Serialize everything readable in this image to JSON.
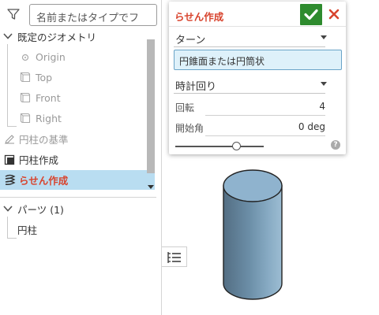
{
  "search": {
    "placeholder": "名前またはタイプでフ"
  },
  "tree": {
    "default_geometry": "既定のジオメトリ",
    "origin": "Origin",
    "top": "Top",
    "front": "Front",
    "right": "Right",
    "cylinder_base": "円柱の基準",
    "cylinder_create": "円柱作成",
    "helix_create": "らせん作成"
  },
  "parts": {
    "header": "パーツ (1)",
    "items": [
      "円柱"
    ]
  },
  "dialog": {
    "title": "らせん作成",
    "type_select": "ターン",
    "face_query": "円錐面または円筒状",
    "direction_select": "時計回り",
    "params": [
      {
        "label": "回転",
        "value": "4"
      },
      {
        "label": "開始角",
        "value": "0 deg"
      }
    ],
    "help": "?"
  },
  "colors": {
    "accent_red": "#d8442e",
    "accept_green": "#2e8b2e",
    "selection_blue": "#b9ddf1",
    "cylinder_fill": "#6c8fa8"
  }
}
